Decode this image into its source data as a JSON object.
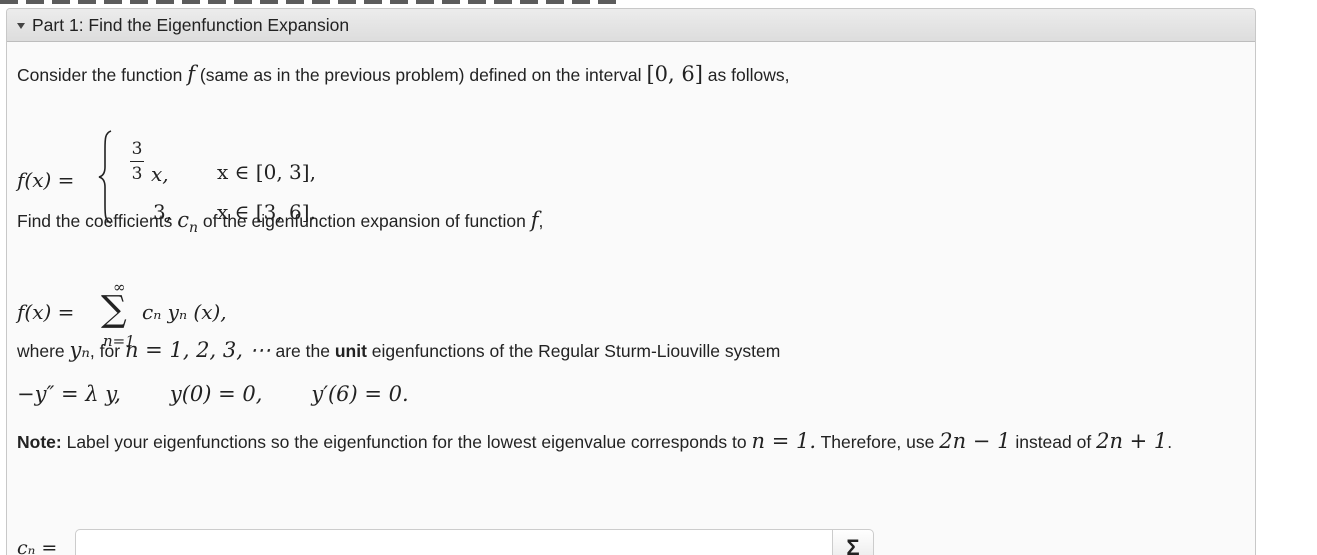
{
  "header": {
    "title": "Part 1: Find the Eigenfunction Expansion"
  },
  "problem": {
    "intro": {
      "before": "Consider the function",
      "f": "f",
      "middle": "(same as in the previous problem) defined on the interval",
      "interval": "[0, 6]",
      "after": "as follows,"
    },
    "piecewise": {
      "lhs": "f(x) =",
      "frac_num": "3",
      "frac_den": "3",
      "piece1_expr": "x,",
      "piece1_cond": "x ∈ [0, 3],",
      "piece2_val": "3,",
      "piece2_cond": "x ∈ [3, 6]."
    },
    "find": {
      "before": "Find the coefficients",
      "cn_c": "c",
      "cn_n": "n",
      "after": "of the eigenfunction expansion of function",
      "f": "f",
      "end": ","
    },
    "sum": {
      "lhs": "f(x) =",
      "upper": "∞",
      "sigma": "∑",
      "lower": "n=1",
      "body": "cₙ yₙ (x),"
    },
    "where": {
      "before": "where",
      "yn": "yₙ",
      "comma": ",",
      "for": "for",
      "n_list": "n = 1, 2, 3, ⋯",
      "mid": "are the",
      "unit": "unit",
      "after": "eigenfunctions of the Regular Sturm-Liouville system"
    },
    "system": {
      "ode": "−y″ = λ y,",
      "bc1": "y(0) = 0,",
      "bc2": "y′(6) = 0."
    },
    "note": {
      "label": "Note:",
      "text1": "Label your eigenfunctions so the eigenfunction for the lowest eigenvalue corresponds to",
      "n_eq": "n = 1.",
      "text2": "Therefore, use",
      "use": "2n − 1",
      "text3": "instead of",
      "instead": "2n + 1",
      "end": "."
    }
  },
  "answer": {
    "label": "cₙ =",
    "value": "",
    "placeholder": "",
    "button": "Σ"
  }
}
